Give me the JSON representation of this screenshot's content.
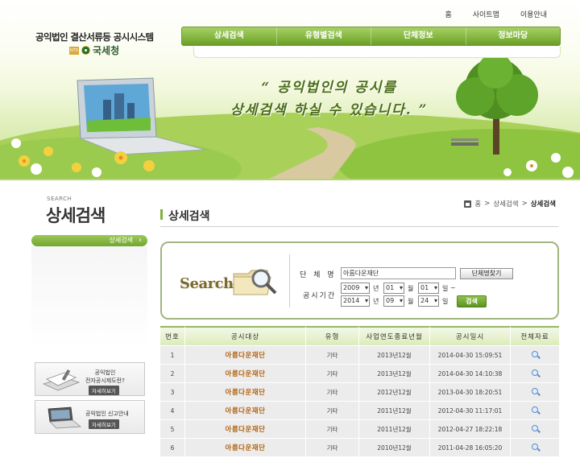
{
  "header": {
    "site_title": "공익법인 결산서류등 공시시스템",
    "agency_badge": "NTS",
    "agency_name": "국세청",
    "slogan_line1": "“ 공익법인의 공시를",
    "slogan_line2": "상세검색 하실 수 있습니다. ”"
  },
  "util_nav": [
    "홈",
    "사이트맵",
    "이용안내"
  ],
  "main_nav": [
    "상세검색",
    "유형별검색",
    "단체정보",
    "정보마당"
  ],
  "sidebar": {
    "title_en": "SEARCH",
    "title": "상세검색",
    "active_item": "상세검색",
    "banners": [
      {
        "line1": "공익법인",
        "line2": "전자공시제도란?",
        "button": "자세히보기"
      },
      {
        "line1": "공익법인 신고안내",
        "line2": "",
        "button": "자세히보기"
      }
    ]
  },
  "breadcrumb": [
    "홈",
    "상세검색",
    "상세검색"
  ],
  "content": {
    "title": "상세검색"
  },
  "search": {
    "logo_text": "Search",
    "name_label": "단 체 명",
    "name_value": "아름다운재단",
    "find_button": "단체명찾기",
    "period_label": "공시기간",
    "from": {
      "year": "2009",
      "month": "01",
      "day": "01"
    },
    "to": {
      "year": "2014",
      "month": "09",
      "day": "24"
    },
    "unit_year": "년",
    "unit_month": "월",
    "unit_day": "일",
    "tilde": "~",
    "search_button": "검색"
  },
  "table": {
    "headers": [
      "번호",
      "공시대상",
      "유형",
      "사업연도종료년월",
      "공시일시",
      "전체자료"
    ],
    "rows": [
      {
        "no": "1",
        "org": "아름다운재단",
        "type": "기타",
        "period": "2013년12월",
        "date": "2014-04-30 15:09:51"
      },
      {
        "no": "2",
        "org": "아름다운재단",
        "type": "기타",
        "period": "2013년12월",
        "date": "2014-04-30 14:10:38"
      },
      {
        "no": "3",
        "org": "아름다운재단",
        "type": "기타",
        "period": "2012년12월",
        "date": "2013-04-30 18:20:51"
      },
      {
        "no": "4",
        "org": "아름다운재단",
        "type": "기타",
        "period": "2011년12월",
        "date": "2012-04-30 11:17:01"
      },
      {
        "no": "5",
        "org": "아름다운재단",
        "type": "기타",
        "period": "2011년12월",
        "date": "2012-04-27 18:22:18"
      },
      {
        "no": "6",
        "org": "아름다운재단",
        "type": "기타",
        "period": "2010년12월",
        "date": "2011-04-28 16:05:20"
      }
    ],
    "view_icon": "magnifier-icon"
  },
  "colors": {
    "nav_green": "#84b840",
    "accent_green": "#7bb03a",
    "org_link": "#b3620e"
  }
}
